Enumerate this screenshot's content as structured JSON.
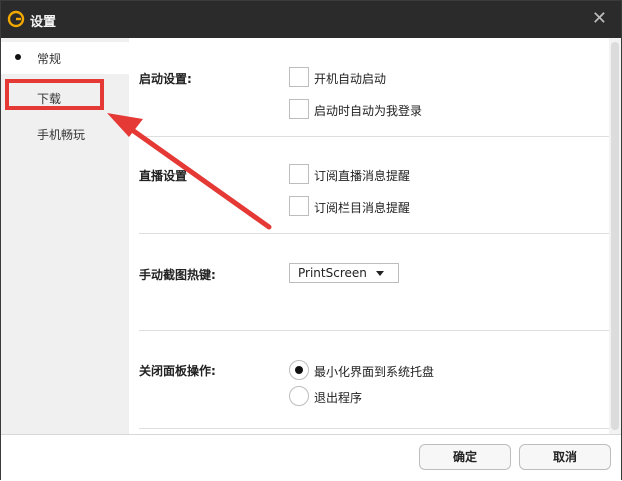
{
  "window": {
    "title": "设置"
  },
  "sidebar": {
    "items": [
      {
        "label": "常规",
        "selected": true
      },
      {
        "label": "下载",
        "highlighted": true
      },
      {
        "label": "手机畅玩"
      }
    ]
  },
  "sections": {
    "startup": {
      "label": "启动设置:",
      "options": [
        {
          "label": "开机自动启动",
          "checked": false
        },
        {
          "label": "启动时自动为我登录",
          "checked": false
        }
      ]
    },
    "live": {
      "label": "直播设置",
      "options": [
        {
          "label": "订阅直播消息提醒",
          "checked": false
        },
        {
          "label": "订阅栏目消息提醒",
          "checked": false
        }
      ]
    },
    "hotkey": {
      "label": "手动截图热键:",
      "value": "PrintScreen"
    },
    "close_panel": {
      "label": "关闭面板操作:",
      "options": [
        {
          "label": "最小化界面到系统托盘",
          "selected": true
        },
        {
          "label": "退出程序",
          "selected": false
        }
      ]
    }
  },
  "footer": {
    "ok_label": "确定",
    "cancel_label": "取消"
  },
  "colors": {
    "titlebar": "#2b2b2b",
    "sidebar": "#f0f0f0",
    "annotation": "#e53935",
    "logo": "#f2a900"
  }
}
